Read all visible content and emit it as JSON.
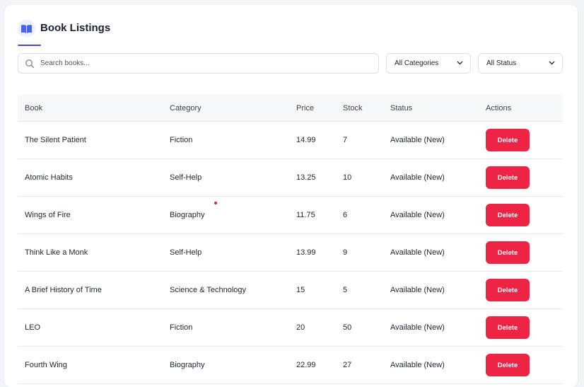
{
  "header": {
    "title": "Book Listings",
    "icon": "open-book-icon"
  },
  "search": {
    "placeholder": "Search books...",
    "value": ""
  },
  "filters": {
    "category": {
      "selected": "All Categories"
    },
    "status": {
      "selected": "All Status"
    }
  },
  "table": {
    "columns": [
      "Book",
      "Category",
      "Price",
      "Stock",
      "Status",
      "Actions"
    ],
    "rows": [
      {
        "book": "The Silent Patient",
        "category": "Fiction",
        "price": "14.99",
        "stock": "7",
        "status": "Available (New)",
        "action": "Delete"
      },
      {
        "book": "Atomic Habits",
        "category": "Self-Help",
        "price": "13.25",
        "stock": "10",
        "status": "Available (New)",
        "action": "Delete"
      },
      {
        "book": "Wings of Fire",
        "category": "Biography",
        "price": "11.75",
        "stock": "6",
        "status": "Available (New)",
        "action": "Delete"
      },
      {
        "book": "Think Like a Monk",
        "category": "Self-Help",
        "price": "13.99",
        "stock": "9",
        "status": "Available (New)",
        "action": "Delete"
      },
      {
        "book": "A Brief History of Time",
        "category": "Science & Technology",
        "price": "15",
        "stock": "5",
        "status": "Available (New)",
        "action": "Delete"
      },
      {
        "book": "LEO",
        "category": "Fiction",
        "price": "20",
        "stock": "50",
        "status": "Available (New)",
        "action": "Delete"
      },
      {
        "book": "Fourth Wing",
        "category": "Biography",
        "price": "22.99",
        "stock": "27",
        "status": "Available (New)",
        "action": "Delete"
      }
    ]
  },
  "colors": {
    "accent": "#4a46d6",
    "danger": "#ee2445",
    "icon": "#4a63e8"
  }
}
